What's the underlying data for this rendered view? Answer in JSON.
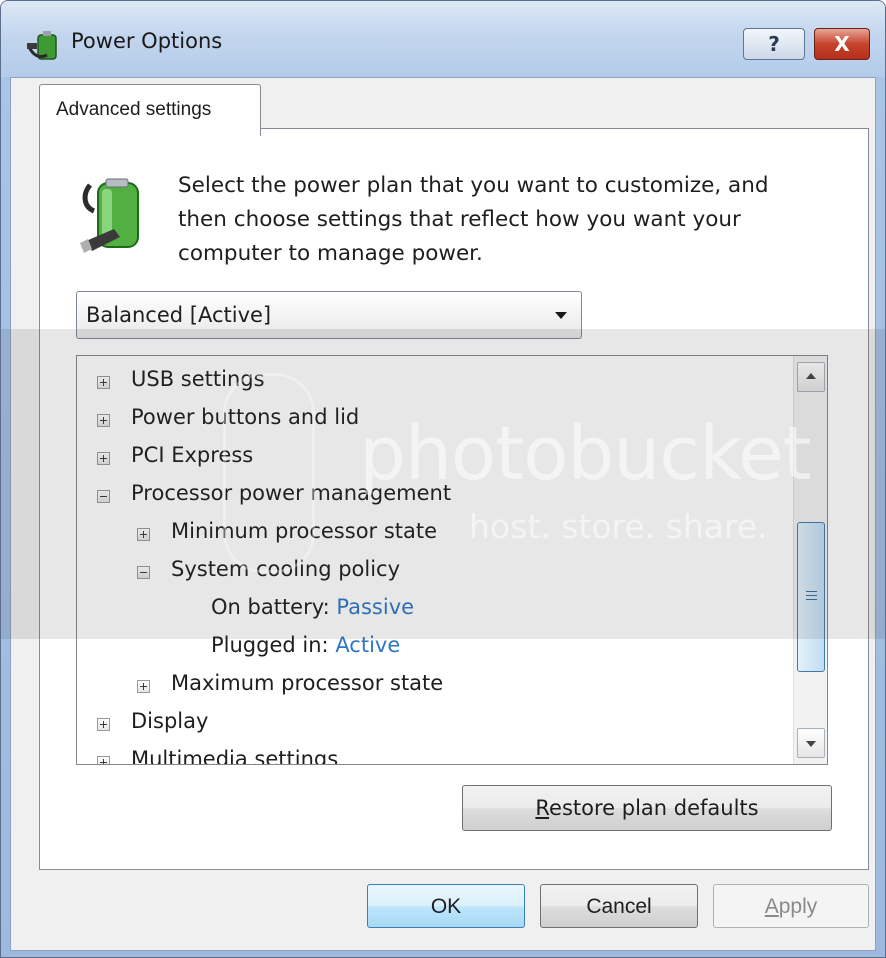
{
  "window": {
    "title": "Power Options"
  },
  "title_buttons": {
    "help": "?",
    "close": "X"
  },
  "tab": {
    "label": "Advanced settings"
  },
  "description": "Select the power plan that you want to customize, and then choose settings that reflect how you want your computer to manage power.",
  "plan_select": {
    "value": "Balanced [Active]"
  },
  "tree": [
    {
      "label": "USB settings",
      "level": 0,
      "expander": "plus"
    },
    {
      "label": "Power buttons and lid",
      "level": 0,
      "expander": "plus"
    },
    {
      "label": "PCI Express",
      "level": 0,
      "expander": "plus"
    },
    {
      "label": "Processor power management",
      "level": 0,
      "expander": "minus"
    },
    {
      "label": "Minimum processor state",
      "level": 1,
      "expander": "plus"
    },
    {
      "label": "System cooling policy",
      "level": 1,
      "expander": "minus"
    },
    {
      "label": "On battery:",
      "value": "Passive",
      "level": 2
    },
    {
      "label": "Plugged in:",
      "value": "Active",
      "level": 2
    },
    {
      "label": "Maximum processor state",
      "level": 1,
      "expander": "plus"
    },
    {
      "label": "Display",
      "level": 0,
      "expander": "plus"
    },
    {
      "label": "Multimedia settings",
      "level": 0,
      "expander": "plus"
    }
  ],
  "buttons": {
    "restore_prefix": "R",
    "restore_rest": "estore plan defaults",
    "ok": "OK",
    "cancel": "Cancel",
    "apply_prefix": "A",
    "apply_rest": "pply"
  },
  "watermark": {
    "text": "photobucket",
    "subtext": "host. store. share."
  }
}
